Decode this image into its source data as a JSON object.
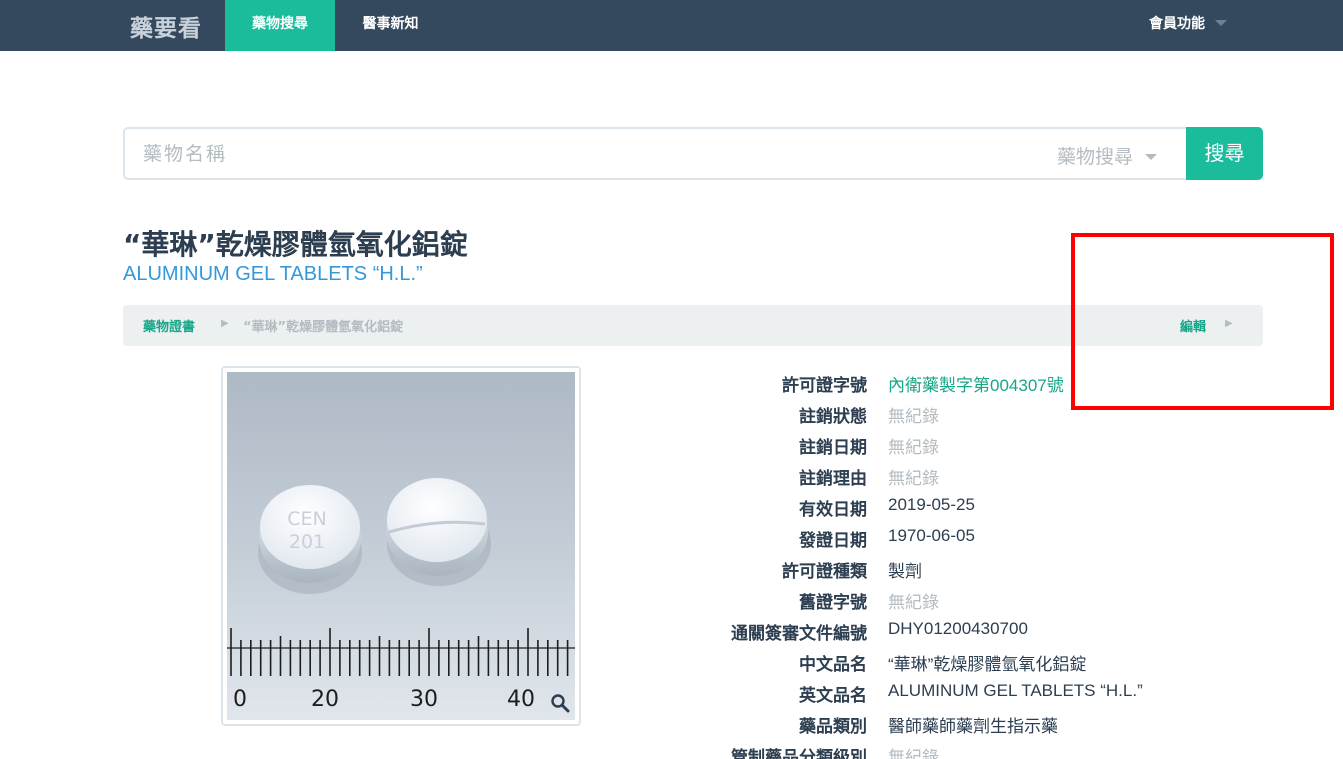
{
  "nav": {
    "brand": "藥要看",
    "items": [
      {
        "label": "藥物搜尋",
        "active": true
      },
      {
        "label": "醫事新知",
        "active": false
      }
    ],
    "member": "會員功能"
  },
  "search": {
    "placeholder": "藥物名稱",
    "type_label": "藥物搜尋",
    "button": "搜尋"
  },
  "drug": {
    "title_zh": "“華琳”乾燥膠體氫氧化鋁錠",
    "title_en": "ALUMINUM GEL TABLETS “H.L.”"
  },
  "breadcrumb": {
    "root": "藥物證書",
    "current": "“華琳”乾燥膠體氫氧化鋁錠",
    "edit": "編輯"
  },
  "image": {
    "pill_imprint_line1": "CEN",
    "pill_imprint_line2": "201",
    "ruler_labels": [
      "0",
      "20",
      "30",
      "40"
    ],
    "zoom_icon": "magnifier-icon"
  },
  "details": [
    {
      "label": "許可證字號",
      "value": "內衛藥製字第004307號",
      "style": "link"
    },
    {
      "label": "註銷狀態",
      "value": "無紀錄",
      "style": "muted"
    },
    {
      "label": "註銷日期",
      "value": "無紀錄",
      "style": "muted"
    },
    {
      "label": "註銷理由",
      "value": "無紀錄",
      "style": "muted"
    },
    {
      "label": "有效日期",
      "value": "2019-05-25",
      "style": "normal"
    },
    {
      "label": "發證日期",
      "value": "1970-06-05",
      "style": "normal"
    },
    {
      "label": "許可證種類",
      "value": "製劑",
      "style": "normal"
    },
    {
      "label": "舊證字號",
      "value": "無紀錄",
      "style": "muted"
    },
    {
      "label": "通關簽審文件編號",
      "value": "DHY01200430700",
      "style": "normal"
    },
    {
      "label": "中文品名",
      "value": "“華琳”乾燥膠體氫氧化鋁錠",
      "style": "normal"
    },
    {
      "label": "英文品名",
      "value": "ALUMINUM GEL TABLETS “H.L.”",
      "style": "normal"
    },
    {
      "label": "藥品類別",
      "value": "醫師藥師藥劑生指示藥",
      "style": "normal"
    },
    {
      "label": "管制藥品分類級別",
      "value": "無紀錄",
      "style": "muted"
    }
  ],
  "colors": {
    "navbar": "#34495e",
    "accent": "#1abc9c",
    "link": "#3498db",
    "muted": "#b4bcc2",
    "highlight": "#ff0000"
  }
}
